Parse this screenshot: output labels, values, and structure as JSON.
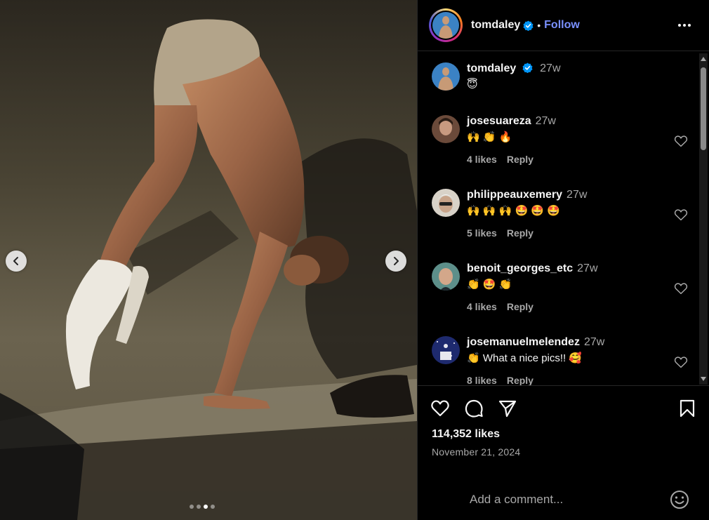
{
  "post": {
    "username": "tomdaley",
    "follow_label": "Follow",
    "separator": "•",
    "caption_time": "27w",
    "caption_text": "😇",
    "likes_count": "114,352 likes",
    "date": "November 21, 2024",
    "carousel": {
      "total": 4,
      "active_index": 2
    }
  },
  "comments": [
    {
      "username": "josesuareza",
      "time": "27w",
      "text": "🙌 👏 🔥",
      "likes": "4 likes",
      "reply": "Reply"
    },
    {
      "username": "philippeauxemery",
      "time": "27w",
      "text": "🙌 🙌 🙌 🤩 🤩 🤩",
      "likes": "5 likes",
      "reply": "Reply"
    },
    {
      "username": "benoit_georges_etc",
      "time": "27w",
      "text": "👏 🤩 👏",
      "likes": "4 likes",
      "reply": "Reply"
    },
    {
      "username": "josemanuelmelendez",
      "time": "27w",
      "text": "👏 What a nice pics!! 🥰",
      "likes": "8 likes",
      "reply": "Reply"
    }
  ],
  "comment_box": {
    "placeholder": "Add a comment..."
  },
  "icons": {
    "more": "more-horizontal-icon",
    "prev": "chevron-left-icon",
    "next": "chevron-right-icon",
    "like": "heart-icon",
    "comment": "comment-icon",
    "share": "share-icon",
    "save": "bookmark-icon",
    "emoji": "emoji-icon",
    "verified": "verified-badge-icon"
  },
  "colors": {
    "follow": "#7a91ff",
    "verified": "#0095f6",
    "background": "#000000",
    "secondary_text": "#a8a8a8"
  }
}
